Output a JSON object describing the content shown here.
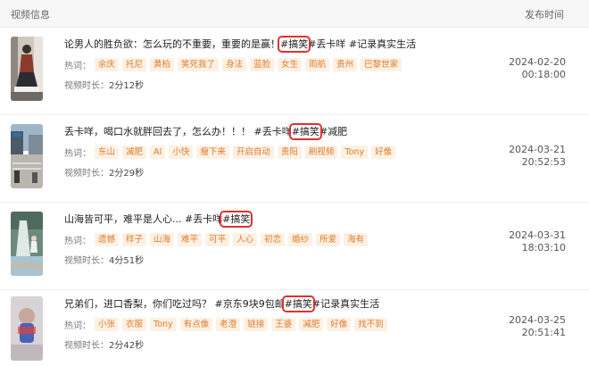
{
  "header": {
    "video_info_label": "视频信息",
    "publish_time_label": "发布时间"
  },
  "labels": {
    "hot_words": "热词：",
    "duration": "视频时长："
  },
  "rows": [
    {
      "title_before": "论男人的胜负欲：怎么玩的不重要，重要的是赢！",
      "title_highlight": "#搞笑",
      "title_after": "#丢卡咩 #记录真实生活",
      "tags": [
        "余庆",
        "托尼",
        "黄柏",
        "笑死我了",
        "身法",
        "蓝脸",
        "女生",
        "雨航",
        "贵州",
        "巴黎世家"
      ],
      "duration": "2分12秒",
      "date": "2024-02-20",
      "time": "00:18:00",
      "thumb_icon": "person-sitting-icon"
    },
    {
      "title_before": "丢卡咩，喝口水就胖回去了，怎么办！！！ #丢卡咩",
      "title_highlight": "#搞笑",
      "title_after": "#减肥",
      "tags": [
        "东山",
        "减肥",
        "AI",
        "小快",
        "瘦下来",
        "开启自动",
        "贵阳",
        "刷视频",
        "Tony",
        "好像"
      ],
      "duration": "2分29秒",
      "date": "2024-03-21",
      "time": "20:52:53",
      "thumb_icon": "street-scene-icon"
    },
    {
      "title_before": "山海皆可平，难平是人心... #丢卡咩",
      "title_highlight": "#搞笑",
      "title_after": "",
      "tags": [
        "遗憾",
        "样子",
        "山海",
        "难平",
        "可平",
        "人心",
        "初恋",
        "婚纱",
        "所爱",
        "海有"
      ],
      "duration": "4分51秒",
      "date": "2024-03-31",
      "time": "18:03:10",
      "thumb_icon": "waterfall-scene-icon"
    },
    {
      "title_before": "兄弟们，进口香梨，你们吃过吗？ #京东9块9包邮",
      "title_highlight": "#搞笑",
      "title_after": "#记录真实生活",
      "tags": [
        "小张",
        "衣服",
        "Tony",
        "有点像",
        "老澄",
        "链接",
        "王婆",
        "减肥",
        "好像",
        "找不到"
      ],
      "duration": "2分42秒",
      "date": "2024-03-25",
      "time": "20:51:41",
      "thumb_icon": "blurred-portrait-icon"
    }
  ]
}
